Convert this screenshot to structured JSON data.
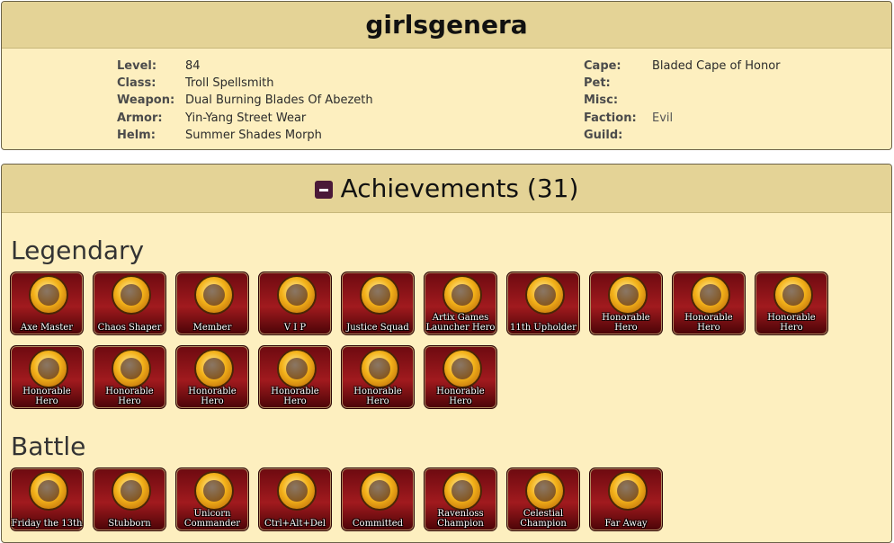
{
  "character": {
    "name": "girlsgenera",
    "level_label": "Level:",
    "level": "84",
    "class_label": "Class:",
    "class": "Troll Spellsmith",
    "weapon_label": "Weapon:",
    "weapon": "Dual Burning Blades Of Abezeth",
    "armor_label": "Armor:",
    "armor": "Yin-Yang Street Wear",
    "helm_label": "Helm:",
    "helm": "Summer Shades Morph",
    "cape_label": "Cape:",
    "cape": "Bladed Cape of Honor",
    "pet_label": "Pet:",
    "pet": "",
    "misc_label": "Misc:",
    "misc": "",
    "faction_label": "Faction:",
    "faction": "Evil",
    "guild_label": "Guild:",
    "guild": ""
  },
  "achievements": {
    "title": "Achievements (31)",
    "collapse_icon": "minus-square-icon",
    "accent_color": "#4a1938",
    "sections": {
      "legendary": {
        "title": "Legendary",
        "badges": [
          "Axe Master",
          "Chaos Shaper",
          "Member",
          "V I P",
          "Justice Squad",
          "Artix Games Launcher Hero",
          "11th Upholder",
          "Honorable Hero",
          "Honorable Hero",
          "Honorable Hero",
          "Honorable Hero",
          "Honorable Hero",
          "Honorable Hero",
          "Honorable Hero",
          "Honorable Hero",
          "Honorable Hero"
        ]
      },
      "battle": {
        "title": "Battle",
        "badges": [
          "Friday the 13th",
          "Stubborn",
          "Unicorn Commander",
          "Ctrl+Alt+Del",
          "Committed",
          "Ravenloss Champion",
          "Celestial Champion",
          "Far Away"
        ]
      }
    }
  }
}
